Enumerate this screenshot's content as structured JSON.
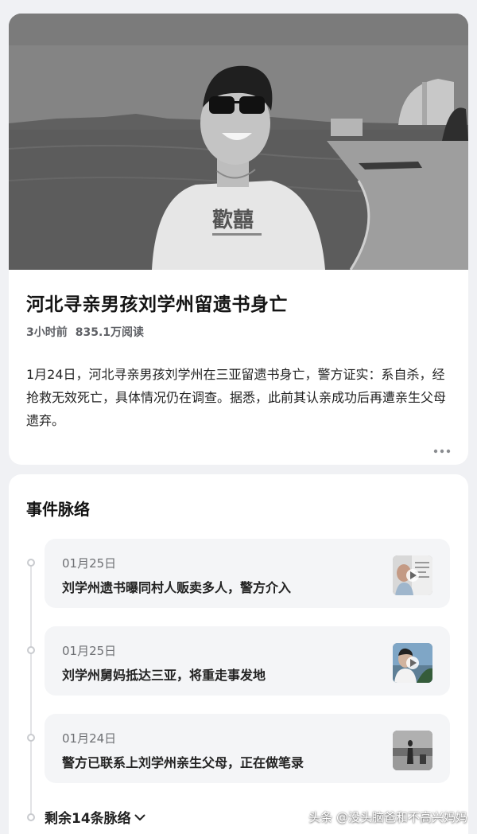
{
  "article": {
    "title": "河北寻亲男孩刘学州留遗书身亡",
    "time_ago": "3小时前",
    "reads": "835.1万阅读",
    "summary": "1月24日，河北寻亲男孩刘学州在三亚留遗书身亡，警方证实：系自杀，经抢救无效死亡，具体情况仍在调查。据悉，此前其认亲成功后再遭亲生父母遗弃。",
    "more_icon": "ellipsis-icon",
    "shirt_text": "歡囍"
  },
  "timeline": {
    "title": "事件脉络",
    "events": [
      {
        "date": "01月25日",
        "text": "刘学州遗书曝同村人贩卖多人，警方介入"
      },
      {
        "date": "01月25日",
        "text": "刘学州舅妈抵达三亚，将重走事发地"
      },
      {
        "date": "01月24日",
        "text": "警方已联系上刘学州亲生父母，正在做笔录"
      }
    ],
    "remaining_label": "剩余14条脉络",
    "expand_icon": "chevron-down-icon"
  },
  "watermark": "头条 @没头脑爸和不高兴妈妈"
}
